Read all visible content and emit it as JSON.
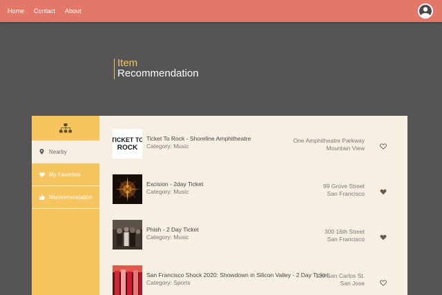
{
  "nav": {
    "home": "Home",
    "contact": "Contact",
    "about": "About"
  },
  "header": {
    "line1": "Item",
    "line2": "Recommendation"
  },
  "sidebar": {
    "logo_icon": "sitemap-icon",
    "items": [
      {
        "label": "Nearby",
        "icon": "map-marker-icon",
        "active": true
      },
      {
        "label": "My Favorites",
        "icon": "heart-icon",
        "active": false
      },
      {
        "label": "Recommendation",
        "icon": "thumbs-up-icon",
        "active": false
      }
    ]
  },
  "items": [
    {
      "title": "Ticket To Rock - Shoreline Amphitheatre",
      "category": "Category: Music",
      "address1": "One Amphitheatre Parkway",
      "address2": "Mountain View",
      "favorited": false
    },
    {
      "title": "Excision - 2day Ticket",
      "category": "Category: Music",
      "address1": "99 Grove Street",
      "address2": "San Francisco",
      "favorited": true
    },
    {
      "title": "Phish - 2 Day Ticket",
      "category": "Category: Music",
      "address1": "300 16th Street",
      "address2": "San Francisco",
      "favorited": true
    },
    {
      "title": "San Francisco Shock 2020: Showdown in Silicon Valley - 2 Day Ticket",
      "category": "Category: Sports",
      "address1": "135 San Carlos St.",
      "address2": "San Jose",
      "favorited": false
    }
  ],
  "thumb_text": {
    "item0_a": "TICKET TO",
    "item0_b": "ROCK"
  },
  "colors": {
    "topbar": "#e2776a",
    "background": "#555555",
    "sidebar": "#f6c560",
    "panel": "#f8efe3",
    "heading_accent": "#f5c563"
  }
}
